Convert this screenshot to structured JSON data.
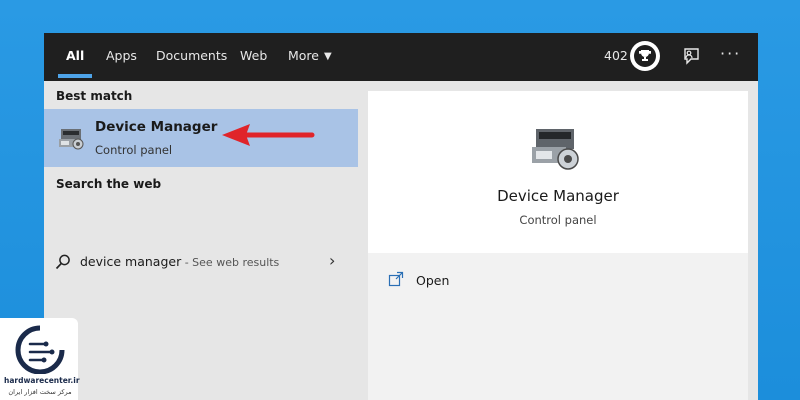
{
  "tabs": [
    {
      "label": "All",
      "active": true
    },
    {
      "label": "Apps"
    },
    {
      "label": "Documents"
    },
    {
      "label": "Web"
    },
    {
      "label": "More"
    }
  ],
  "header": {
    "points": "402",
    "icons": [
      "trophy-badge-icon",
      "feedback-icon",
      "more-options-icon"
    ],
    "more_dots": "···"
  },
  "left": {
    "best_match_label": "Best match",
    "best_match": {
      "title": "Device Manager",
      "subtitle": "Control panel",
      "icon": "device-manager-icon"
    },
    "search_web_label": "Search the web",
    "web_result": {
      "query": "device manager",
      "suffix": " - See web results",
      "icon": "search-icon"
    }
  },
  "preview": {
    "title": "Device Manager",
    "subtitle": "Control panel",
    "actions": [
      {
        "label": "Open",
        "icon": "open-icon"
      }
    ]
  },
  "watermark": {
    "site": "hardwarecenter.ir",
    "tagline": "مرکز سخت افزار ایران"
  },
  "colors": {
    "desktop": "#1a8fdc",
    "topbar": "#1f1f1f",
    "accent": "#4ea3e8",
    "selection": "#a9c3e6",
    "arrow": "#e0242a"
  }
}
